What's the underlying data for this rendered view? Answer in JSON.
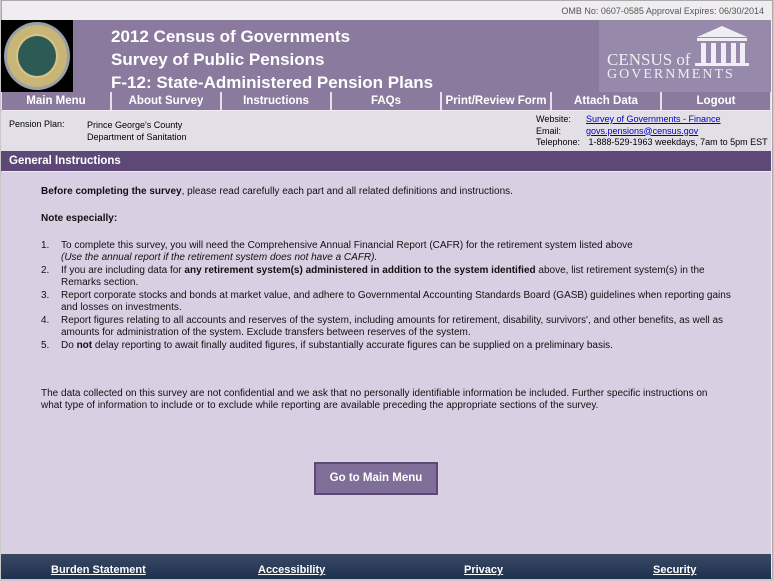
{
  "omb": "OMB No:  0607-0585   Approval Expires:  06/30/2014",
  "header": {
    "title1": "2012 Census of Governments",
    "title2": "Survey of Public Pensions",
    "title3": "F-12:  State-Administered Pension Plans",
    "logo_text1": "CENSUS of",
    "logo_text2": "GOVERNMENTS",
    "seal_text": "U.S. DEPARTMENT OF COMMERCE BUREAU OF THE CENSUS"
  },
  "nav": [
    "Main Menu",
    "About Survey",
    "Instructions",
    "FAQs",
    "Print/Review Form",
    "Attach Data",
    "Logout"
  ],
  "info": {
    "plan_label": "Pension Plan:",
    "plan_line1": "Prince George's County",
    "plan_line2": "Department of Sanitation",
    "website_label": "Website:",
    "website": "Survey of Governments - Finance",
    "email_label": "Email:",
    "email": "govs.pensions@census.gov",
    "phone_label": "Telephone:",
    "phone": "1-888-529-1963  weekdays, 7am to 5pm EST"
  },
  "section_title": "General Instructions",
  "content": {
    "intro_bold": "Before completing the survey",
    "intro_rest": ", please read carefully each part and all related definitions and instructions.",
    "note": "Note especially:",
    "items": [
      {
        "n": "1.",
        "a": "To complete this survey, you will need the Comprehensive Annual Financial Report (CAFR) for the retirement system listed above ",
        "i": "(Use the annual report if the retirement system does not have a CAFR)."
      },
      {
        "n": "2.",
        "a": "If you are including data for ",
        "b": "any retirement system(s) administered in addition to the system identified",
        "c": " above, list retirement system(s) in the Remarks section."
      },
      {
        "n": "3.",
        "a": "Report corporate stocks and bonds at market value, and adhere to Governmental Accounting Standards Board (GASB) guidelines when reporting gains and losses on investments."
      },
      {
        "n": "4.",
        "a": "Report figures relating to all accounts and reserves of the system, including amounts for retirement, disability, survivors', and other benefits, as well as amounts for administration of the system.  Exclude transfers between reserves of the system."
      },
      {
        "n": "5.",
        "a": "Do ",
        "b": "not",
        "c": " delay reporting to await finally audited figures, if substantially accurate figures can be supplied on a preliminary basis."
      }
    ],
    "closing": "The data collected on this survey are not confidential and we ask that no personally identifiable information be included. Further specific instructions on what type of information to include or to exclude while reporting are available preceding the appropriate sections of the survey.",
    "button": "Go to Main Menu"
  },
  "footer": [
    "Burden Statement",
    "Accessibility",
    "Privacy",
    "Security"
  ],
  "colors": {
    "header": "#8a7b9e",
    "section": "#5d4878",
    "content_bg": "#d9cfe2",
    "footer": "#1f3150"
  }
}
